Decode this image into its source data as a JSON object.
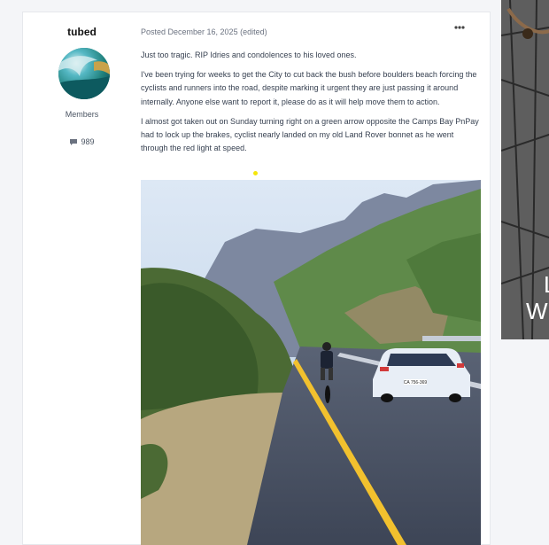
{
  "author": {
    "name": "tubed",
    "group": "Members",
    "post_count": "989",
    "icons": {
      "avatar": "wave-avatar-image",
      "comment": "comment-icon"
    }
  },
  "post": {
    "date_line": "Posted December 16, 2025 (edited)",
    "menu_icon": "more-dots-icon",
    "paragraphs": [
      "Just too tragic. RIP Idries and condolences to his loved ones.",
      "I've been trying for weeks to get the City to cut back the bush before boulders beach forcing the cyclists and runners into the road, despite marking it urgent they are just passing it around internally. Anyone else want to report it, please do as it will help move them to action.",
      "I almost got taken out on Sunday turning right on a green arrow opposite the Camps Bay PnPay had to lock up the brakes, cyclist nearly landed on my old Land Rover bonnet as he went through the red light at speed."
    ],
    "photo": "road-cyclist-photo",
    "photo_plate_text": "CA 756-369"
  },
  "side_card": {
    "text_lines": [
      "L",
      "W"
    ]
  },
  "colors": {
    "page_bg": "#f4f5f8",
    "card_bg": "#ffffff",
    "text": "#374151",
    "muted": "#6b7280",
    "sky": "#c9dced"
  }
}
